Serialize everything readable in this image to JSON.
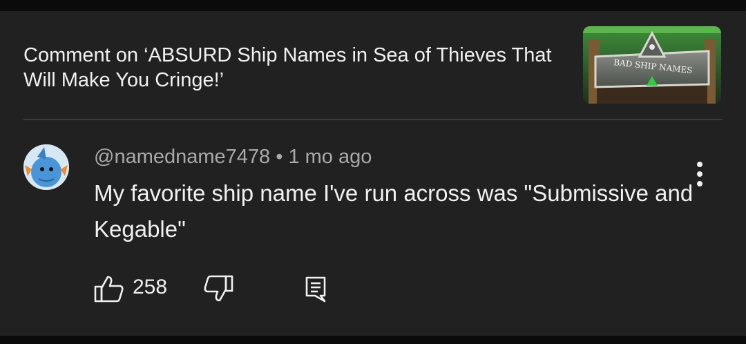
{
  "header": {
    "title": "Comment on ‘ABSURD Ship Names in Sea of Thieves That Will Make You Cringe!’",
    "thumbnail_text": "BAD SHIP NAMES"
  },
  "comment": {
    "author": "@namedname7478",
    "separator": " • ",
    "time": "1 mo ago",
    "text": "My favorite ship name I've run across was \"Submissive and Kegable\"",
    "likes": "258"
  },
  "icons": {
    "like": "thumbs-up-icon",
    "dislike": "thumbs-down-icon",
    "reply": "reply-icon",
    "more": "more-vert-icon"
  },
  "colors": {
    "background": "#212121",
    "text": "#f1f1f1",
    "meta_text": "#aaaaaa",
    "divider": "#3d3d3d"
  }
}
